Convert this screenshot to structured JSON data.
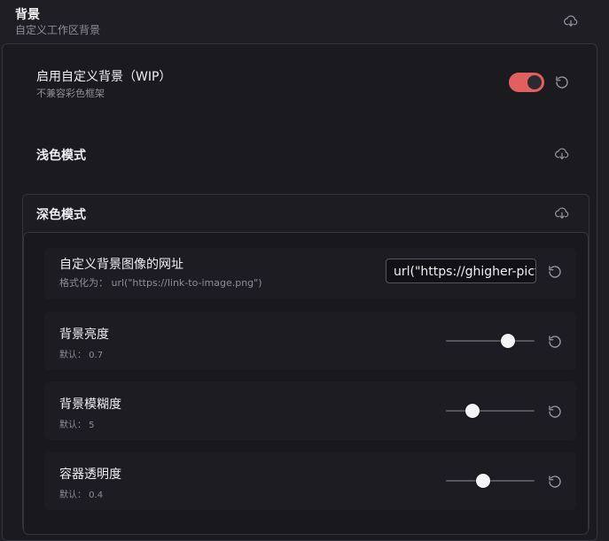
{
  "section": {
    "title": "背景",
    "subtitle": "自定义工作区背景",
    "download_icon": "cloud-download-icon"
  },
  "custom_background": {
    "title": "启用自定义背景（WIP）",
    "desc": "不兼容彩色框架",
    "enabled": true,
    "reset_icon": "reset-icon"
  },
  "light_mode": {
    "title": "浅色模式",
    "download_icon": "cloud-download-icon"
  },
  "dark_mode": {
    "title": "深色模式",
    "download_icon": "cloud-download-icon",
    "settings": {
      "image_url": {
        "title": "自定义背景图像的网址",
        "desc": "格式化为：  url(\"https://link-to-image.png\")",
        "value": "url(\"https://ghigher-pictu",
        "reset_icon": "reset-icon"
      },
      "brightness": {
        "title": "背景亮度",
        "default_label": "默认：  0.7",
        "value": 0.7,
        "reset_icon": "reset-icon"
      },
      "blur": {
        "title": "背景模糊度",
        "default_label": "默认：  5",
        "value": 0.3,
        "reset_icon": "reset-icon"
      },
      "opacity": {
        "title": "容器透明度",
        "default_label": "默认：  0.4",
        "value": 0.42,
        "reset_icon": "reset-icon"
      }
    }
  },
  "colors": {
    "accent": "#e05f5f",
    "background": "#1e1e24"
  }
}
